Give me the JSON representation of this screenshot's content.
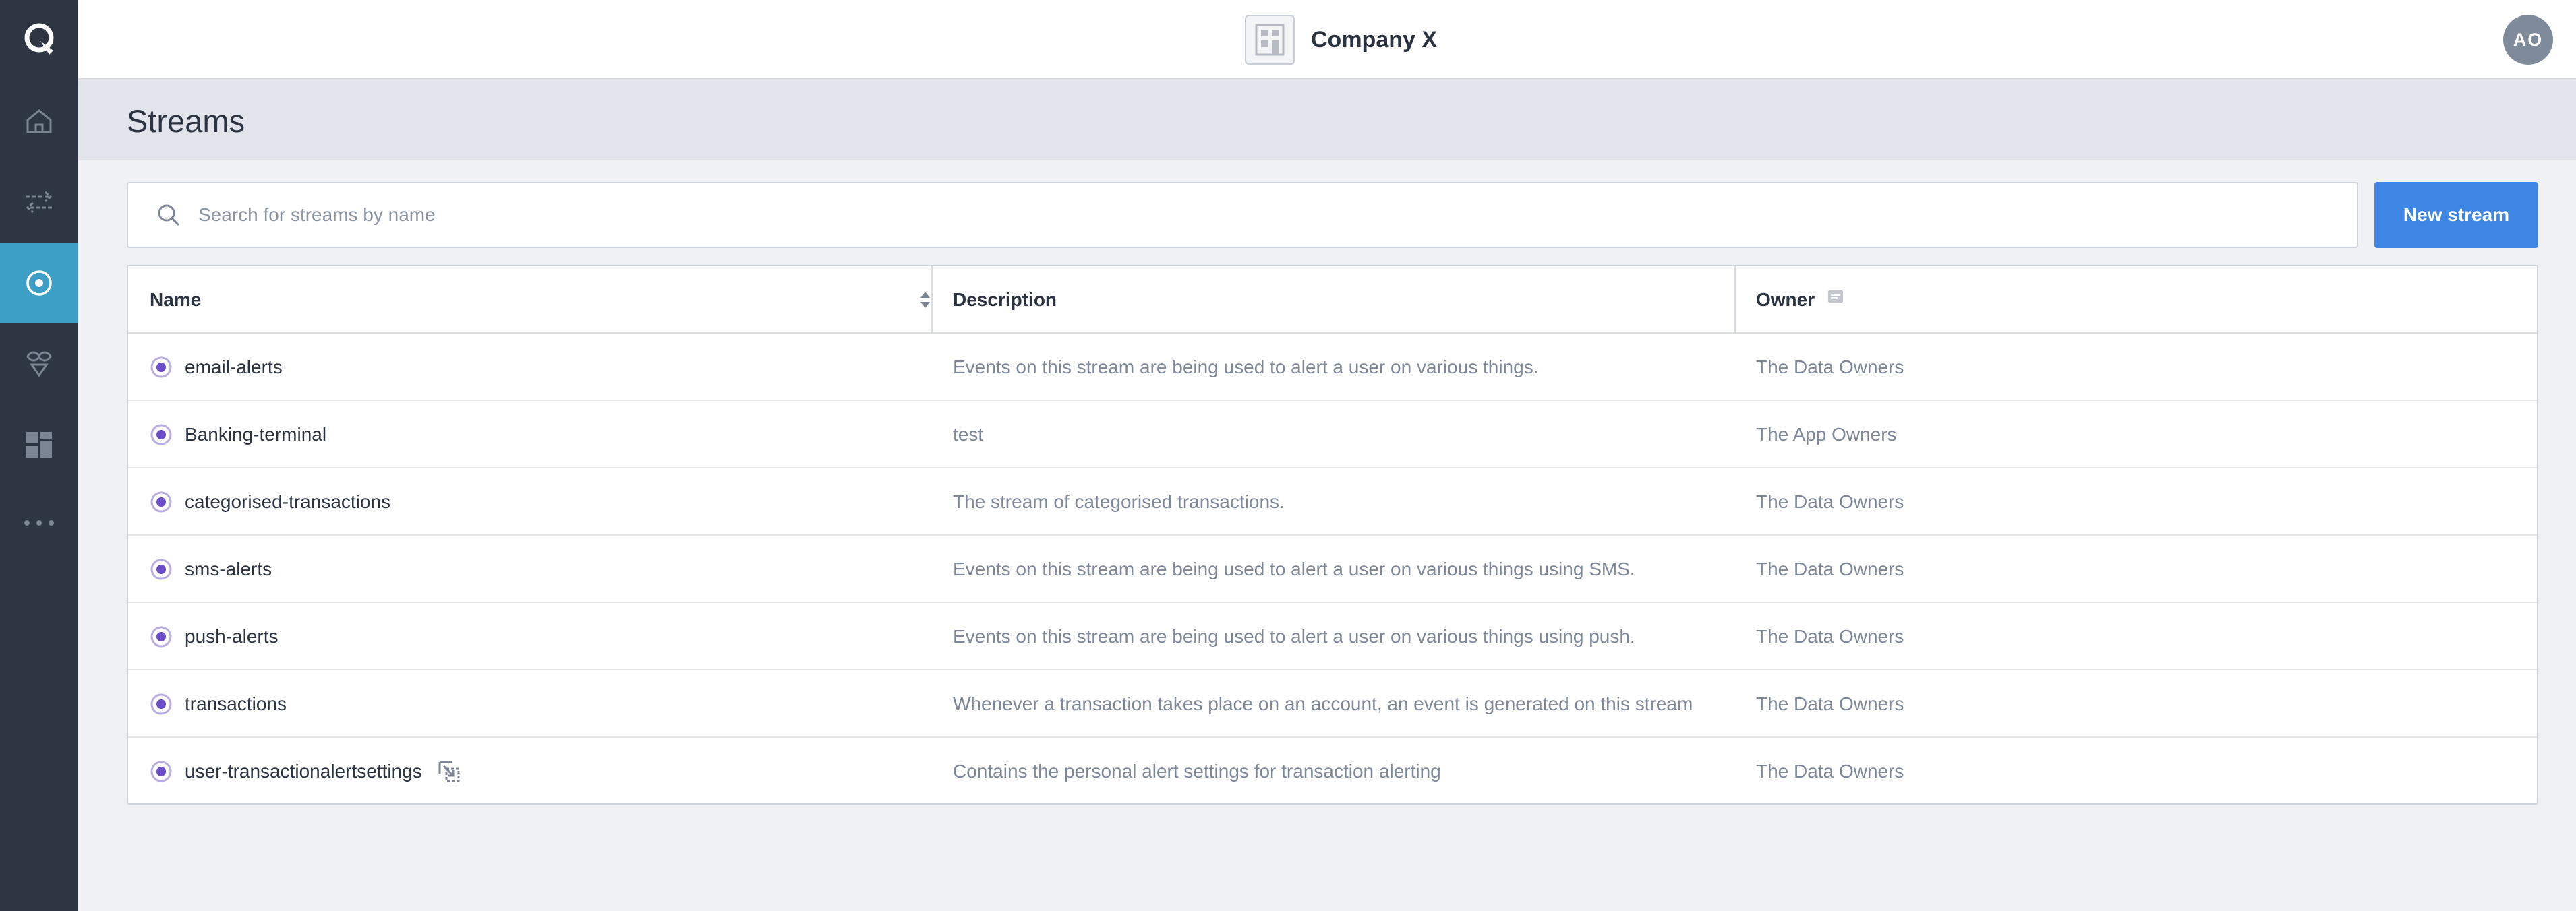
{
  "sidebar": {
    "items": [
      {
        "name": "home",
        "icon": "home-icon",
        "active": false
      },
      {
        "name": "transfer",
        "icon": "arrows-icon",
        "active": false
      },
      {
        "name": "streams",
        "icon": "stream-icon",
        "active": true
      },
      {
        "name": "connectors",
        "icon": "connector-icon",
        "active": false
      },
      {
        "name": "dashboard",
        "icon": "grid-icon",
        "active": false
      },
      {
        "name": "more",
        "icon": "more-icon",
        "active": false
      }
    ]
  },
  "topbar": {
    "company_name": "Company X",
    "avatar_initials": "AO"
  },
  "page": {
    "title": "Streams"
  },
  "search": {
    "placeholder": "Search for streams by name",
    "value": ""
  },
  "actions": {
    "new_stream_label": "New stream"
  },
  "table": {
    "columns": {
      "name": "Name",
      "description": "Description",
      "owner": "Owner"
    },
    "rows": [
      {
        "name": "email-alerts",
        "description": "Events on this stream are being used to alert a user on various things.",
        "owner": "The Data Owners"
      },
      {
        "name": "Banking-terminal",
        "description": "test",
        "owner": "The App Owners"
      },
      {
        "name": "categorised-transactions",
        "description": "The stream of categorised transactions.",
        "owner": "The Data Owners"
      },
      {
        "name": "sms-alerts",
        "description": "Events on this stream are being used to alert a user on various things using SMS.",
        "owner": "The Data Owners"
      },
      {
        "name": "push-alerts",
        "description": "Events on this stream are being used to alert a user on various things using push.",
        "owner": "The Data Owners"
      },
      {
        "name": "transactions",
        "description": "Whenever a transaction takes place on an account, an event is generated on this stream",
        "owner": "The Data Owners"
      },
      {
        "name": "user-transactionalertsettings",
        "description": "Contains the personal alert settings for transaction alerting",
        "owner": "The Data Owners"
      }
    ]
  },
  "colors": {
    "sidebar_bg": "#2d3642",
    "active_item": "#3d9fc5",
    "primary_button": "#3e86e3",
    "stream_dot": "#6b4fc9"
  }
}
